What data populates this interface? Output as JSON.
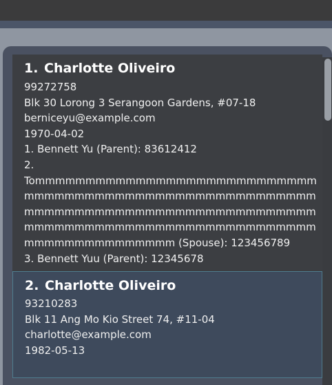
{
  "persons": [
    {
      "index": "1.",
      "name": "Charlotte Oliveiro",
      "phone": "99272758",
      "address": "Blk 30 Lorong 3 Serangoon Gardens, #07-18",
      "email": "berniceyu@example.com",
      "birthday": "1970-04-02",
      "contacts": [
        "1. Bennett Yu (Parent): 83612412",
        "2.",
        "Tommmmmmmmmmmmmmmmmmmmmmmmmmmmmmmmmmmmmmmmmmmmmmmmmmmmmmmmmmmmmmmmmmmmmmmmmmmmmmmmmmmmmmmmmmmmmmmmmmmmmmmmmmmmmmmmmmmmmmmmmmmmmmmmmm (Spouse): 123456789",
        "3. Bennett Yuu (Parent): 12345678"
      ]
    },
    {
      "index": "2.",
      "name": "Charlotte Oliveiro",
      "phone": "93210283",
      "address": "Blk 11 Ang Mo Kio Street 74, #11-04",
      "email": "charlotte@example.com",
      "birthday": "1982-05-13"
    }
  ]
}
